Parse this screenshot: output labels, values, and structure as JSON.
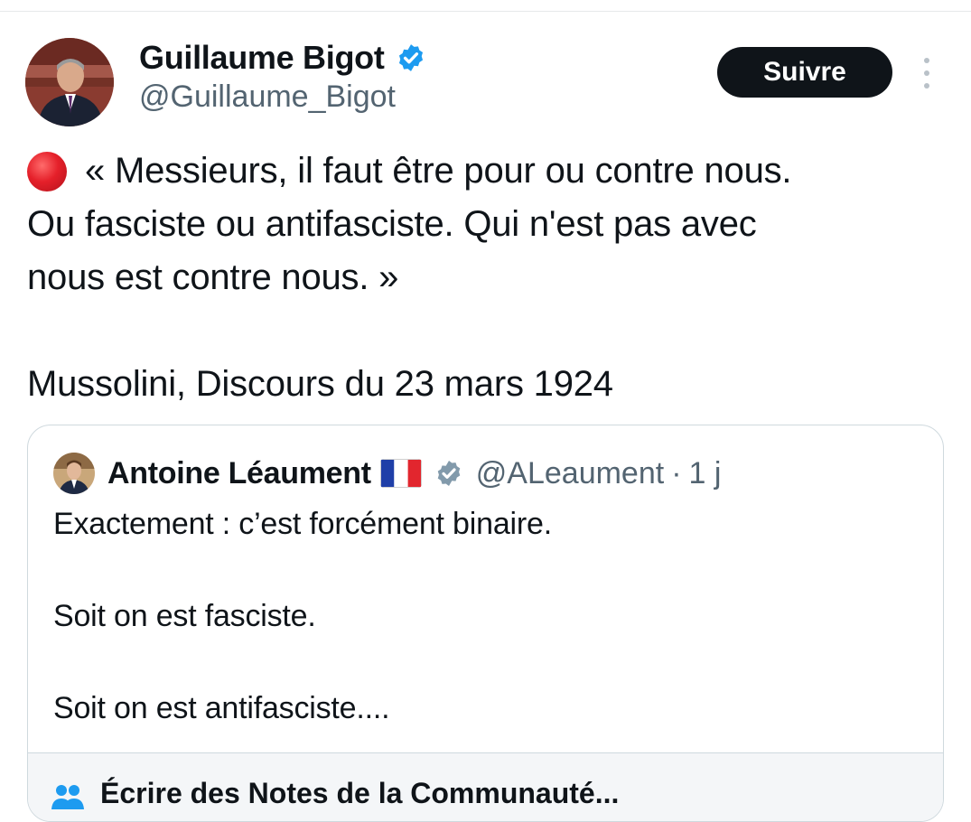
{
  "tweet": {
    "author": {
      "name": "Guillaume Bigot",
      "handle": "@Guillaume_Bigot",
      "verified": true
    },
    "follow_label": "Suivre",
    "text_lines": [
      "« Messieurs, il faut être pour ou contre nous.",
      "Ou fasciste ou antifasciste. Qui n'est pas avec",
      "nous est contre nous. »"
    ],
    "attribution": "Mussolini, Discours du 23 mars 1924"
  },
  "quoted_tweet": {
    "author": {
      "name": "Antoine Léaument",
      "handle": "@ALeaument",
      "separator": "·",
      "time": "1 j"
    },
    "text_lines": [
      "Exactement : c’est forcément binaire.",
      "",
      "Soit on est fasciste.",
      "",
      "Soit on est antifasciste...."
    ],
    "community_note_partial": "Écrire des Notes de la Communauté..."
  },
  "colors": {
    "text": "#0f1419",
    "secondary": "#536471",
    "verified_blue": "#1d9bf0",
    "verified_grey": "#829aab",
    "follow_bg": "#0f1419",
    "border": "#cfd9de"
  },
  "icons": [
    "verified-badge-icon",
    "more-options-icon",
    "red-circle-emoji",
    "french-flag-icon",
    "grey-verified-badge-icon",
    "people-icon"
  ]
}
